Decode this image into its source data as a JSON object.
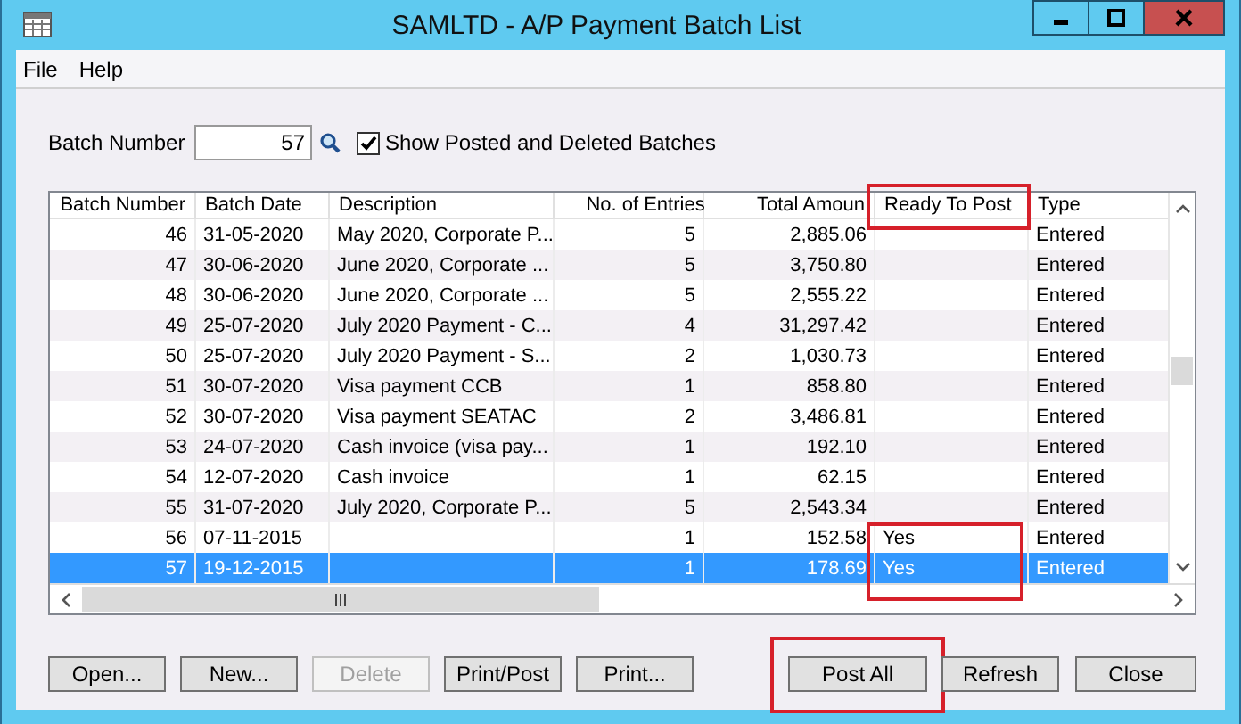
{
  "window": {
    "title": "SAMLTD - A/P Payment Batch List"
  },
  "menu": [
    "File",
    "Help"
  ],
  "batch_number": {
    "label": "Batch Number",
    "value": "57"
  },
  "show_posted": {
    "label": "Show Posted and Deleted Batches",
    "checked": true
  },
  "table": {
    "columns": [
      {
        "label": "Batch Number",
        "highlighted": false
      },
      {
        "label": "Batch Date",
        "highlighted": false
      },
      {
        "label": "Description",
        "highlighted": false
      },
      {
        "label": "No. of Entries",
        "highlighted": false
      },
      {
        "label": "Total Amoun",
        "highlighted": false
      },
      {
        "label": "Ready To Post",
        "highlighted": true
      },
      {
        "label": "Type",
        "highlighted": false
      }
    ],
    "rows": [
      {
        "cells": [
          "46",
          "31-05-2020",
          "May 2020, Corporate P...",
          "5",
          "2,885.06",
          "",
          "Entered"
        ],
        "selected": false,
        "flagged": false
      },
      {
        "cells": [
          "47",
          "30-06-2020",
          "June 2020, Corporate ...",
          "5",
          "3,750.80",
          "",
          "Entered"
        ],
        "selected": false,
        "flagged": false
      },
      {
        "cells": [
          "48",
          "30-06-2020",
          "June 2020, Corporate ...",
          "5",
          "2,555.22",
          "",
          "Entered"
        ],
        "selected": false,
        "flagged": false
      },
      {
        "cells": [
          "49",
          "25-07-2020",
          "July 2020 Payment - C...",
          "4",
          "31,297.42",
          "",
          "Entered"
        ],
        "selected": false,
        "flagged": false
      },
      {
        "cells": [
          "50",
          "25-07-2020",
          "July 2020 Payment - S...",
          "2",
          "1,030.73",
          "",
          "Entered"
        ],
        "selected": false,
        "flagged": false
      },
      {
        "cells": [
          "51",
          "30-07-2020",
          "Visa payment CCB",
          "1",
          "858.80",
          "",
          "Entered"
        ],
        "selected": false,
        "flagged": false
      },
      {
        "cells": [
          "52",
          "30-07-2020",
          "Visa payment SEATAC",
          "2",
          "3,486.81",
          "",
          "Entered"
        ],
        "selected": false,
        "flagged": false
      },
      {
        "cells": [
          "53",
          "24-07-2020",
          "Cash invoice (visa pay...",
          "1",
          "192.10",
          "",
          "Entered"
        ],
        "selected": false,
        "flagged": false
      },
      {
        "cells": [
          "54",
          "12-07-2020",
          "Cash invoice",
          "1",
          "62.15",
          "",
          "Entered"
        ],
        "selected": false,
        "flagged": false
      },
      {
        "cells": [
          "55",
          "31-07-2020",
          "July 2020, Corporate P...",
          "5",
          "2,543.34",
          "",
          "Entered"
        ],
        "selected": false,
        "flagged": false
      },
      {
        "cells": [
          "56",
          "07-11-2015",
          "",
          "1",
          "152.58",
          "Yes",
          "Entered"
        ],
        "selected": false,
        "flagged": true
      },
      {
        "cells": [
          "57",
          "19-12-2015",
          "",
          "1",
          "178.69",
          "Yes",
          "Entered"
        ],
        "selected": true,
        "flagged": true
      }
    ]
  },
  "buttons": [
    {
      "label": "Open...",
      "disabled": false,
      "highlighted": false
    },
    {
      "label": "New...",
      "disabled": false,
      "highlighted": false
    },
    {
      "label": "Delete",
      "disabled": true,
      "highlighted": false
    },
    {
      "label": "Print/Post",
      "disabled": false,
      "highlighted": false
    },
    {
      "label": "Print...",
      "disabled": false,
      "highlighted": false
    },
    {
      "label": "Post All",
      "disabled": false,
      "highlighted": true
    },
    {
      "label": "Refresh",
      "disabled": false,
      "highlighted": false
    },
    {
      "label": "Close",
      "disabled": false,
      "highlighted": false
    }
  ]
}
